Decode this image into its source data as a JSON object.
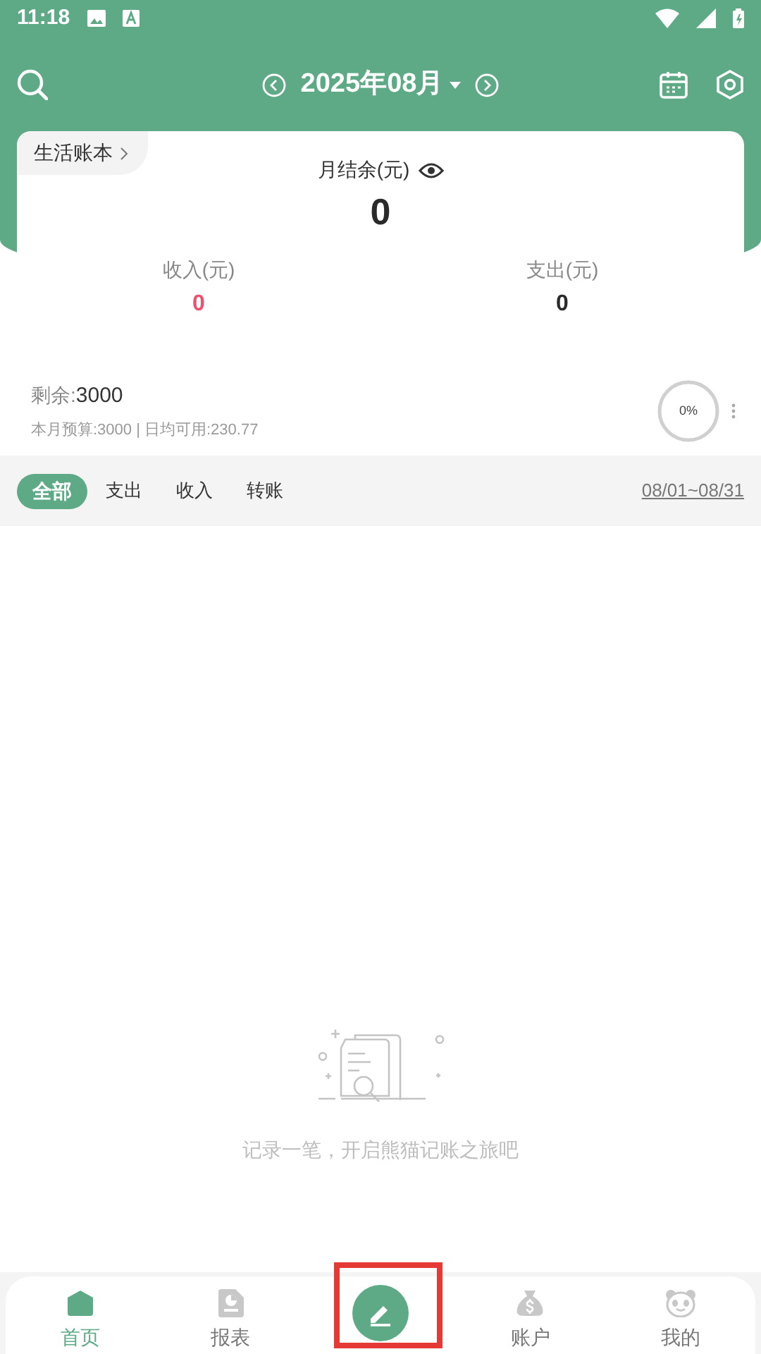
{
  "status_bar": {
    "time": "11:18"
  },
  "header": {
    "month": "2025年08月"
  },
  "summary": {
    "book": "生活账本",
    "balance_label": "月结余(元)",
    "balance": "0",
    "income_label": "收入(元)",
    "income": "0",
    "expense_label": "支出(元)",
    "expense": "0"
  },
  "budget": {
    "remaining_label": "剩余:",
    "remaining": "3000",
    "detail": "本月预算:3000 | 日均可用:230.77",
    "percent": "0%",
    "level": 0
  },
  "filters": [
    {
      "label": "全部",
      "selected": true
    },
    {
      "label": "支出",
      "selected": false
    },
    {
      "label": "收入",
      "selected": false
    },
    {
      "label": "转账",
      "selected": false
    }
  ],
  "date_range": "08/01~08/31",
  "empty": {
    "message": "记录一笔，开启熊猫记账之旅吧"
  },
  "nav": [
    {
      "kind": "home",
      "label": "首页",
      "selected": true
    },
    {
      "kind": "report",
      "label": "报表",
      "selected": false
    },
    {
      "kind": "add",
      "highlighted": true
    },
    {
      "kind": "account",
      "label": "账户",
      "selected": false
    },
    {
      "kind": "me",
      "label": "我的",
      "selected": false
    }
  ]
}
